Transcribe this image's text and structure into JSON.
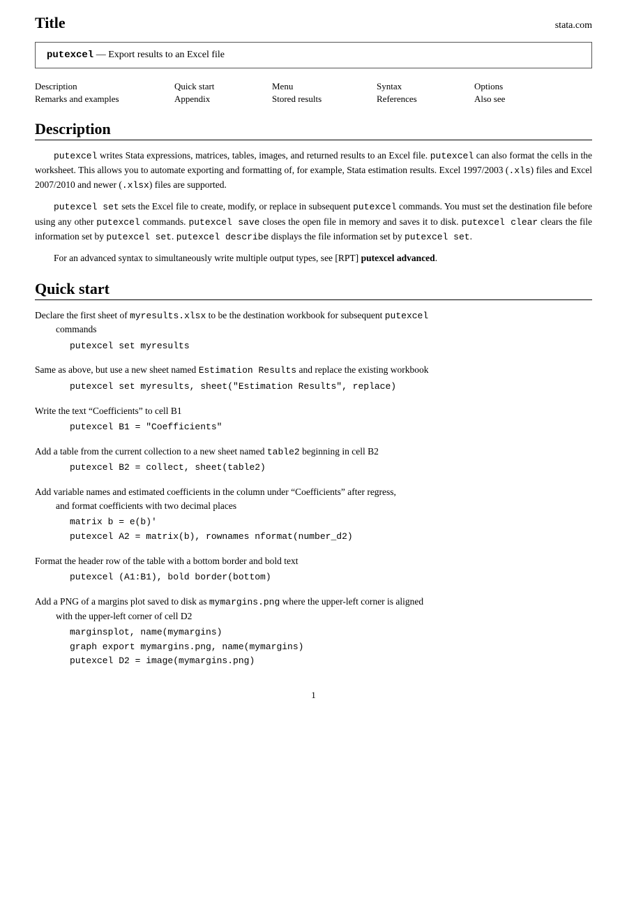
{
  "title": {
    "text": "Title",
    "site": "stata.com"
  },
  "header": {
    "cmd": "putexcel",
    "dash": "—",
    "description": "Export results to an Excel file"
  },
  "nav": {
    "items": [
      {
        "label": "Description",
        "row": 1,
        "col": 1
      },
      {
        "label": "Quick start",
        "row": 1,
        "col": 2
      },
      {
        "label": "Menu",
        "row": 1,
        "col": 3
      },
      {
        "label": "Syntax",
        "row": 1,
        "col": 4
      },
      {
        "label": "Options",
        "row": 1,
        "col": 5
      },
      {
        "label": "Remarks and examples",
        "row": 2,
        "col": 1
      },
      {
        "label": "Appendix",
        "row": 2,
        "col": 2
      },
      {
        "label": "Stored results",
        "row": 2,
        "col": 3
      },
      {
        "label": "References",
        "row": 2,
        "col": 4
      },
      {
        "label": "Also see",
        "row": 2,
        "col": 5
      }
    ]
  },
  "description_section": {
    "heading": "Description",
    "para1": "putexcel writes Stata expressions, matrices, tables, images, and returned results to an Excel file. putexcel can also format the cells in the worksheet. This allows you to automate exporting and formatting of, for example, Stata estimation results. Excel 1997/2003 (.xls) files and Excel 2007/2010 and newer (.xlsx) files are supported.",
    "para2_parts": {
      "before": "putexcel set",
      "text1": " sets the Excel file to create, modify, or replace in subsequent ",
      "cmd1": "putexcel",
      "text2": " commands. You must set the destination file before using any other ",
      "cmd2": "putexcel",
      "text3": " commands. ",
      "cmd3": "putexcel save",
      "text4": " closes the open file in memory and saves it to disk. ",
      "cmd4": "putexcel clear",
      "text5": " clears the file information set by ",
      "cmd5": "putexcel set",
      "text6": ". ",
      "cmd6": "putexcel describe",
      "text7": " displays the file information set by ",
      "cmd7": "putexcel set",
      "text8": "."
    },
    "para3": "For an advanced syntax to simultaneously write multiple output types, see [RPT] putexcel advanced."
  },
  "quickstart_section": {
    "heading": "Quick start",
    "items": [
      {
        "desc": "Declare the first sheet of myresults.xlsx to be the destination workbook for subsequent putexcel commands",
        "code": [
          "putexcel set myresults"
        ]
      },
      {
        "desc": "Same as above, but use a new sheet named Estimation Results and replace the existing workbook",
        "code": [
          "putexcel set myresults, sheet(\"Estimation Results\", replace)"
        ]
      },
      {
        "desc": "Write the text “Coefficients” to cell B1",
        "code": [
          "putexcel B1 = \"Coefficients\""
        ]
      },
      {
        "desc": "Add a table from the current collection to a new sheet named table2 beginning in cell B2",
        "code": [
          "putexcel B2 = collect, sheet(table2)"
        ]
      },
      {
        "desc": "Add variable names and estimated coefficients in the column under “Coefficients” after regress, and format coefficients with two decimal places",
        "code": [
          "matrix b = e(b)'",
          "putexcel A2 = matrix(b), rownames nformat(number_d2)"
        ]
      },
      {
        "desc": "Format the header row of the table with a bottom border and bold text",
        "code": [
          "putexcel (A1:B1), bold border(bottom)"
        ]
      },
      {
        "desc": "Add a PNG of a margins plot saved to disk as mymargins.png where the upper-left corner is aligned with the upper-left corner of cell D2",
        "code": [
          "marginsplot, name(mymargins)",
          "graph export mymargins.png, name(mymargins)",
          "putexcel D2 = image(mymargins.png)"
        ]
      }
    ]
  },
  "page_number": "1"
}
